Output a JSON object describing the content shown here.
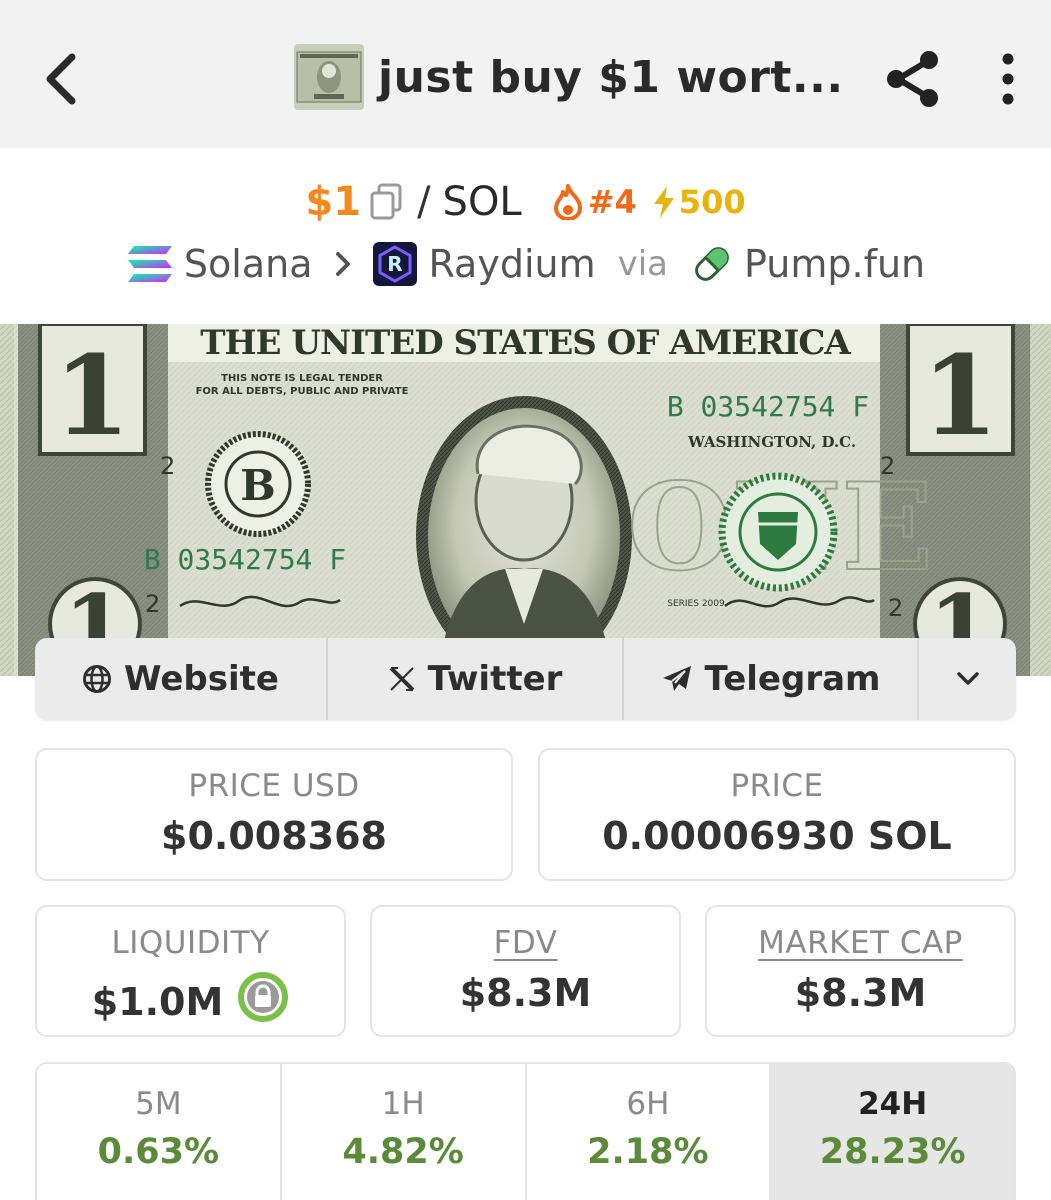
{
  "header": {
    "title": "just buy $1 wort...",
    "icons": {
      "back": "chevron-left-icon",
      "share": "share-icon",
      "more": "more-vertical-icon"
    }
  },
  "pair": {
    "base": "$1",
    "separator": "/",
    "quote": "SOL",
    "rank": "#4",
    "boost": "500",
    "colors": {
      "base": "#f5881f",
      "rank": "#f06a1a",
      "boost": "#e8b30b"
    }
  },
  "chain": {
    "network": "Solana",
    "dex": "Raydium",
    "via": "via",
    "launchpad": "Pump.fun"
  },
  "banner": {
    "top_text": "THE UNITED STATES OF AMERICA",
    "legal_tender": "THIS NOTE IS LEGAL TENDER",
    "legal_tender_2": "FOR ALL DEBTS, PUBLIC AND PRIVATE",
    "serial": "B 03542754 F",
    "city": "WASHINGTON, D.C.",
    "fed_letter": "B",
    "denomination": "1",
    "plate": "2",
    "series": "SERIES 2009"
  },
  "socials": {
    "website": "Website",
    "twitter": "Twitter",
    "telegram": "Telegram"
  },
  "stats": {
    "price_usd": {
      "label": "PRICE USD",
      "value": "$0.008368"
    },
    "price_native": {
      "label": "PRICE",
      "value": "0.00006930 SOL"
    },
    "liquidity": {
      "label": "LIQUIDITY",
      "value": "$1.0M"
    },
    "fdv": {
      "label": "FDV",
      "value": "$8.3M"
    },
    "market_cap": {
      "label": "MARKET CAP",
      "value": "$8.3M"
    }
  },
  "timeframes": [
    {
      "label": "5M",
      "value": "0.63%"
    },
    {
      "label": "1H",
      "value": "4.82%"
    },
    {
      "label": "6H",
      "value": "2.18%"
    },
    {
      "label": "24H",
      "value": "28.23%",
      "active": true
    }
  ],
  "colors": {
    "positive": "#5a8a3a",
    "lock": "#7cc04a"
  }
}
